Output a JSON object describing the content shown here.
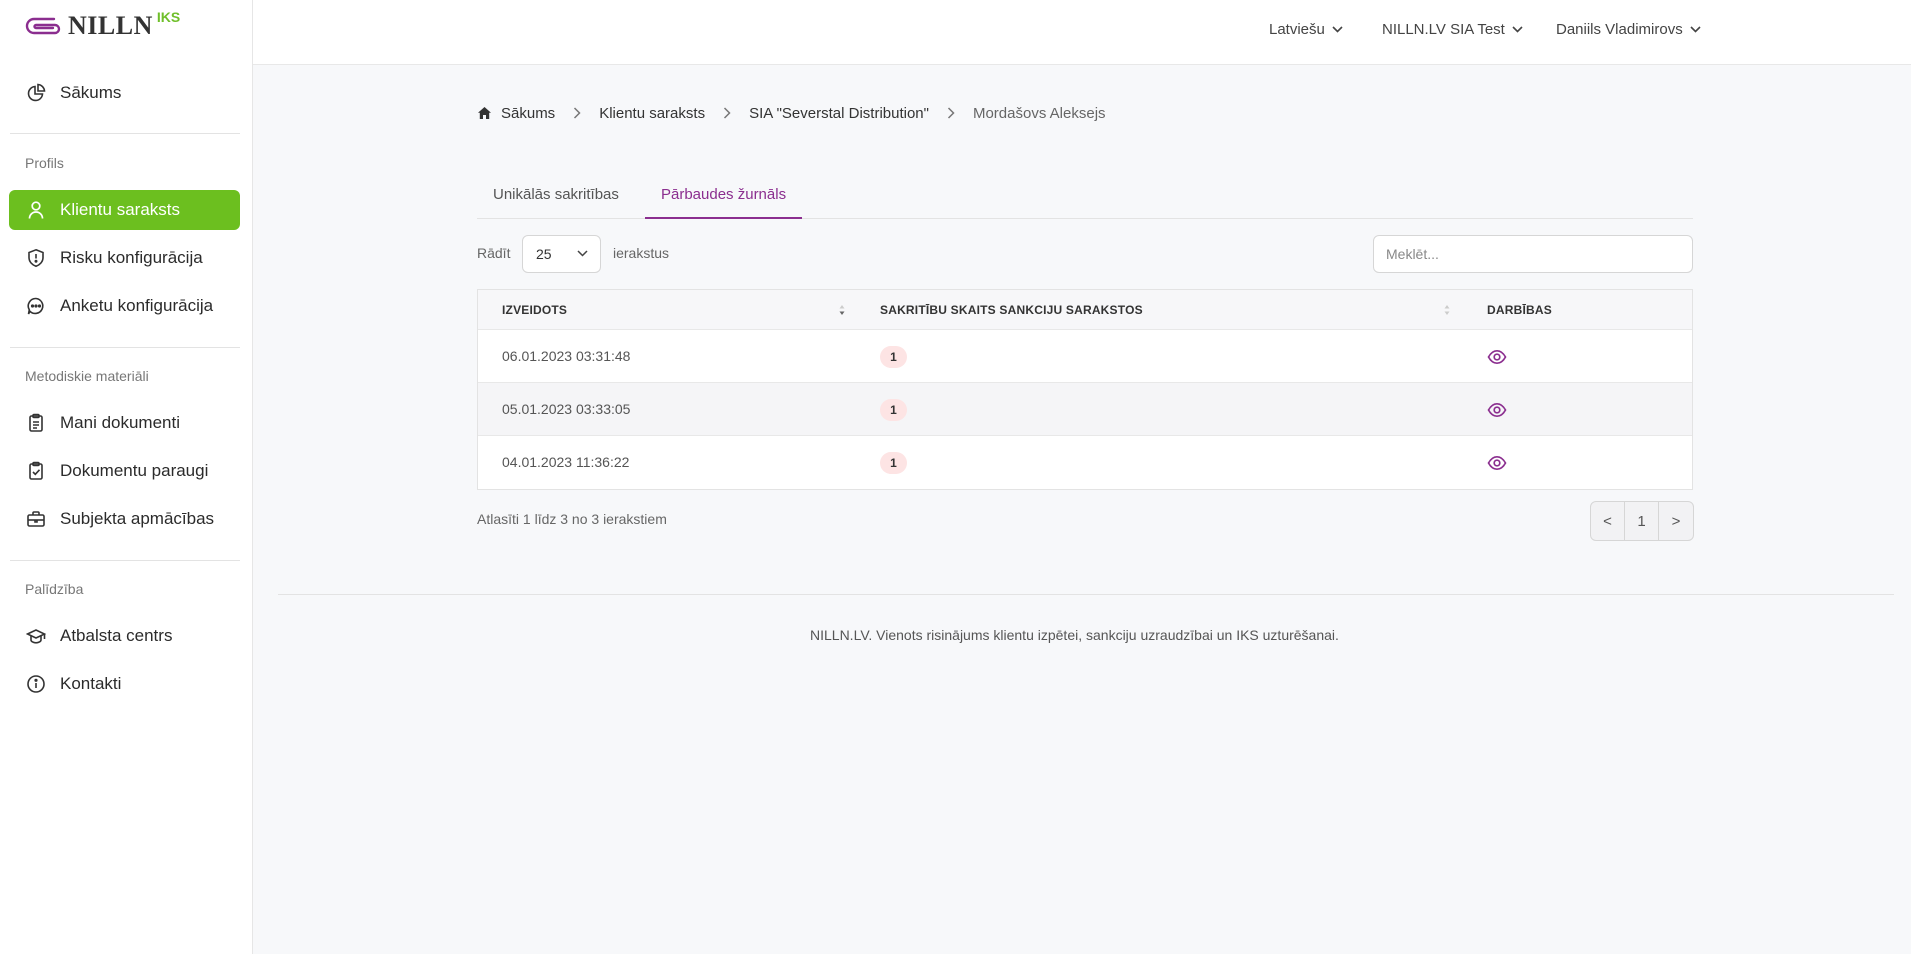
{
  "brand": {
    "name": "NILLN",
    "suffix": "IKS",
    "accent": "#6cbf1f",
    "purple": "#8b2e8f"
  },
  "sidebar": {
    "home": {
      "label": "Sākums",
      "icon": "pie-chart-icon"
    },
    "sections": [
      {
        "title": "Profils",
        "items": [
          {
            "label": "Klientu saraksts",
            "icon": "user-icon",
            "active": true
          },
          {
            "label": "Risku konfigurācija",
            "icon": "shield-icon"
          },
          {
            "label": "Anketu konfigurācija",
            "icon": "chat-icon"
          }
        ]
      },
      {
        "title": "Metodiskie materiāli",
        "items": [
          {
            "label": "Mani dokumenti",
            "icon": "clipboard-icon"
          },
          {
            "label": "Dokumentu paraugi",
            "icon": "clipboard-check-icon"
          },
          {
            "label": "Subjekta apmācības",
            "icon": "briefcase-icon"
          }
        ]
      },
      {
        "title": "Palīdzība",
        "items": [
          {
            "label": "Atbalsta centrs",
            "icon": "graduation-cap-icon"
          },
          {
            "label": "Kontakti",
            "icon": "info-icon"
          }
        ]
      }
    ]
  },
  "header": {
    "language": "Latviešu",
    "company": "NILLN.LV SIA Test",
    "user": "Daniils Vladimirovs"
  },
  "breadcrumb": [
    "Sākums",
    "Klientu saraksts",
    "SIA \"Severstal Distribution\"",
    "Mordašovs Aleksejs"
  ],
  "tabs": [
    {
      "label": "Unikālās sakritības",
      "active": false
    },
    {
      "label": "Pārbaudes žurnāls",
      "active": true
    }
  ],
  "controls": {
    "show_label": "Rādīt",
    "page_size": "25",
    "entries_label": "ierakstus",
    "search_placeholder": "Meklēt..."
  },
  "table": {
    "columns": [
      "IZVEIDOTS",
      "SAKRITĪBU SKAITS SANKCIJU SARAKSTOS",
      "DARBĪBAS"
    ],
    "rows": [
      {
        "created": "06.01.2023 03:31:48",
        "matches": "1"
      },
      {
        "created": "05.01.2023 03:33:05",
        "matches": "1"
      },
      {
        "created": "04.01.2023 11:36:22",
        "matches": "1"
      }
    ]
  },
  "info": "Atlasīti 1 līdz 3 no 3 ierakstiem",
  "pager": {
    "prev": "<",
    "page": "1",
    "next": ">"
  },
  "footer": "NILLN.LV. Vienots risinājums klientu izpētei, sankciju uzraudzībai un IKS uzturēšanai."
}
